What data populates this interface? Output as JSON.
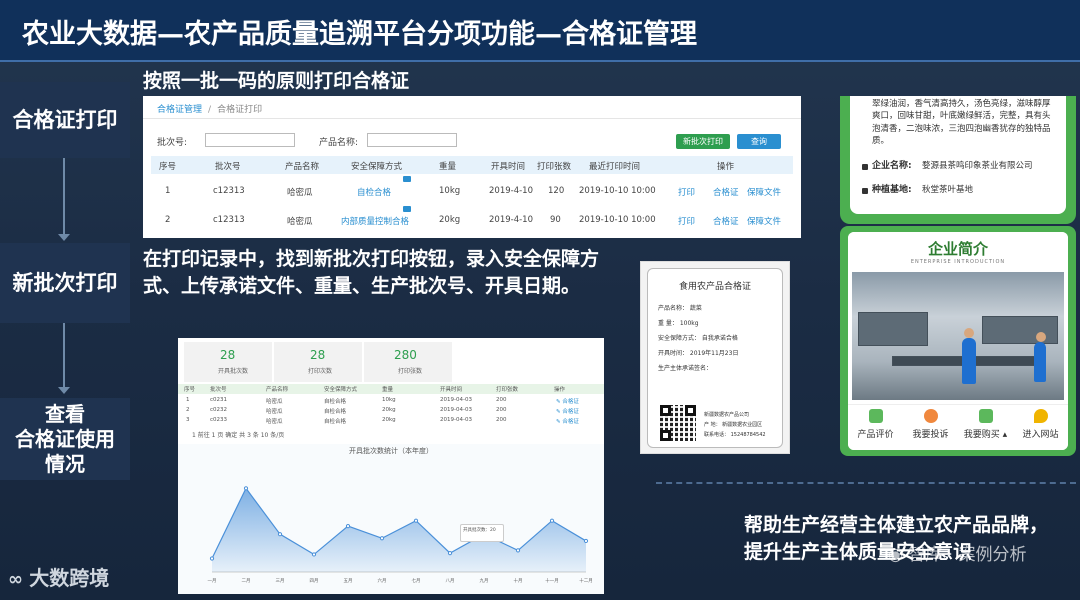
{
  "slide": {
    "title": "农业大数据—农产品质量追溯平台分项功能—合格证管理"
  },
  "steps": [
    {
      "label": "合格证打印"
    },
    {
      "label": "新批次打印"
    },
    {
      "label": "查看\n合格证使用\n情况"
    }
  ],
  "captions": {
    "step1": "按照一批一码的原则打印合格证",
    "step2": "在打印记录中，找到新批次打印按钮，录入安全保障方式、上传承诺文件、重量、生产批次号、开具日期。",
    "bottom_right": "帮助生产经营主体建立农产品品牌，提升生产主体质量安全意识"
  },
  "print_panel": {
    "breadcrumb": [
      "合格证管理",
      "合格证打印"
    ],
    "batch_label": "批次号:",
    "product_label": "产品名称:",
    "new_batch_button": "新批次打印",
    "query_button": "查询",
    "colors": {
      "green": "#2e9e4f",
      "blue": "#2a8fd0"
    },
    "columns": [
      "序号",
      "批次号",
      "产品名称",
      "安全保障方式",
      "重量",
      "开具时间",
      "打印张数",
      "最近打印时间",
      "操作"
    ],
    "rows": [
      {
        "no": "1",
        "batch": "c12313",
        "product": "哈密瓜",
        "method": "自检合格",
        "weight": "10kg",
        "date": "2019-4-10",
        "count": "120",
        "last": "2019-10-10 10:00",
        "ops": [
          "打印",
          "合格证",
          "保障文件"
        ]
      },
      {
        "no": "2",
        "batch": "c12313",
        "product": "哈密瓜",
        "method": "内部质量控制合格",
        "weight": "20kg",
        "date": "2019-4-10",
        "count": "90",
        "last": "2019-10-10 10:00",
        "ops": [
          "打印",
          "合格证",
          "保障文件"
        ]
      }
    ]
  },
  "certificate": {
    "title": "食用农产品合格证",
    "lines": [
      "产品名称：  蔬菜",
      "重    量：  100kg",
      "安全保障方式：  自我承诺合格",
      "开具时间：  2019年11月23日",
      "生产主体承诺签名："
    ],
    "footer": [
      "新疆数据农产品公司",
      "产    地：  新疆数据农业园区",
      "联系电话：  15248784542"
    ]
  },
  "phone_top": {
    "text_lines": [
      "翠绿油润，香气清高持久，汤色亮绿，滋味醇厚",
      "爽口，回味甘甜，叶底嫩绿鲜活，完整，具有头",
      "泡清香，二泡味浓，三泡四泡幽香犹存的独特品",
      "质。"
    ],
    "company_label": "企业名称:",
    "company_value": "婺源县茶鸣印象茶业有限公司",
    "base_label": "种植基地:",
    "base_value": "秋堂茶叶基地"
  },
  "phone_bottom": {
    "banner_title": "企业简介",
    "banner_sub": "ENTERPRISE INTRODUCTION",
    "nav": [
      {
        "label": "产品评价",
        "icon": "review-icon",
        "color": "#5cb85c"
      },
      {
        "label": "我要投诉",
        "icon": "headset-icon",
        "color": "#f0883e"
      },
      {
        "label": "我要购买 ▴",
        "icon": "cart-icon",
        "color": "#5cb85c"
      },
      {
        "label": "进入网站",
        "icon": "location-icon",
        "color": "#f0b400"
      }
    ]
  },
  "dashboard": {
    "stats": [
      {
        "value": "28",
        "label": "开具批次数"
      },
      {
        "value": "28",
        "label": "打印次数"
      },
      {
        "value": "280",
        "label": "打印张数"
      }
    ],
    "columns": [
      "序号",
      "批次号",
      "产品名称",
      "安全保障方式",
      "重量",
      "开具时间",
      "打印张数",
      "操作"
    ],
    "rows": [
      {
        "no": "1",
        "batch": "c0231",
        "product": "哈密瓜",
        "method": "自检合格",
        "weight": "10kg",
        "date": "2019-04-03",
        "count": "200",
        "op": "✎ 合格证"
      },
      {
        "no": "2",
        "batch": "c0232",
        "product": "哈密瓜",
        "method": "自检合格",
        "weight": "20kg",
        "date": "2019-04-03",
        "count": "200",
        "op": "✎ 合格证"
      },
      {
        "no": "3",
        "batch": "c0233",
        "product": "哈密瓜",
        "method": "自检合格",
        "weight": "20kg",
        "date": "2019-04-03",
        "count": "200",
        "op": "✎ 合格证"
      }
    ],
    "pager": "1   前往   1   页  确定  共 3 条  10 条/页",
    "chart_title": "开具批次数统计（本年度）",
    "tooltip": "开具批次数：20"
  },
  "chart_data": {
    "type": "area",
    "title": "开具批次数统计（本年度）",
    "categories": [
      "一月",
      "二月",
      "三月",
      "四月",
      "五月",
      "六月",
      "七月",
      "八月",
      "九月",
      "十月",
      "十一月",
      "十二月"
    ],
    "series": [
      {
        "values": [
          10,
          62,
          28,
          13,
          34,
          25,
          38,
          14,
          28,
          16,
          38,
          23
        ]
      }
    ],
    "ylim": [
      0,
      80
    ],
    "color": "#4a90d9"
  },
  "branding": {
    "logo": "大数跨境",
    "wechat": "智库 · 案例分析"
  }
}
